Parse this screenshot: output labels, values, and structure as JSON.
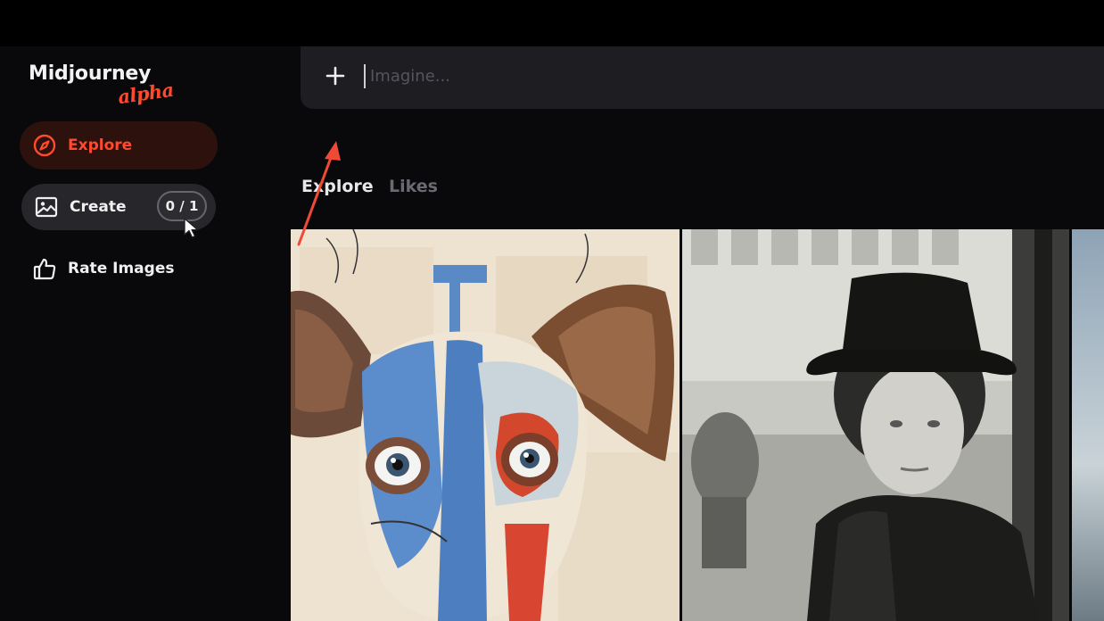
{
  "sidebar": {
    "brand": {
      "name": "Midjourney",
      "tag": "alpha"
    },
    "items": [
      {
        "label": "Explore",
        "icon": "compass-icon",
        "active": true
      },
      {
        "label": "Create",
        "icon": "image-icon",
        "counter": "0 / 1"
      },
      {
        "label": "Rate Images",
        "icon": "thumbs-up-icon"
      }
    ]
  },
  "prompt": {
    "button_icon": "plus-icon",
    "placeholder": "Imagine...",
    "value": ""
  },
  "tabs": [
    {
      "label": "Explore",
      "active": true
    },
    {
      "label": "Likes",
      "active": false
    }
  ],
  "gallery": {
    "images": [
      {
        "subject": "abstract mixed-media painting of a blue-faced dog with large eyes"
      },
      {
        "subject": "black and white photo of an elderly woman in a black hat and fur coat"
      },
      {
        "subject": "partial image, cropped"
      }
    ]
  },
  "colors": {
    "accent": "#ff4a2e",
    "background": "#09090c",
    "surface": "#1d1d22",
    "annotation_arrow": "#f04a36"
  }
}
